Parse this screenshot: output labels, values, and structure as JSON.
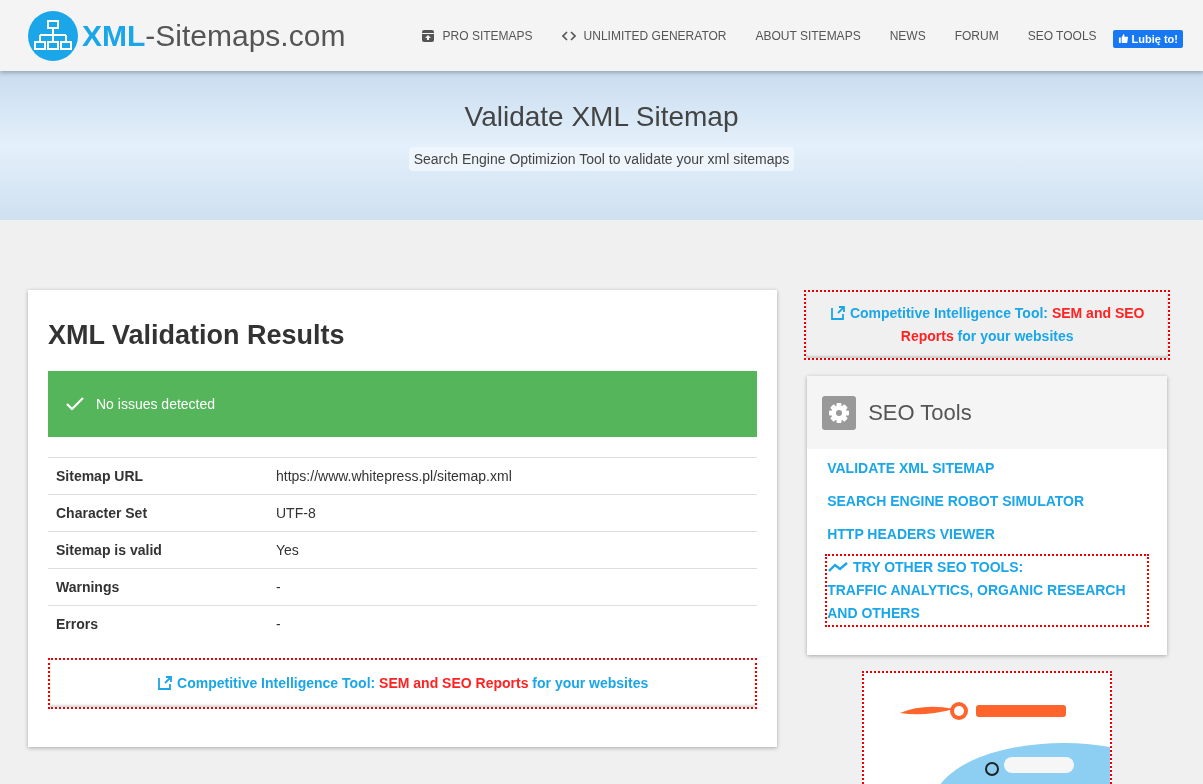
{
  "header": {
    "logo": {
      "brand": "XML",
      "rest": "-Sitemaps.com"
    },
    "nav": [
      {
        "label": "PRO SITEMAPS"
      },
      {
        "label": "UNLIMITED GENERATOR"
      },
      {
        "label": "ABOUT SITEMAPS"
      },
      {
        "label": "NEWS"
      },
      {
        "label": "FORUM"
      },
      {
        "label": "SEO TOOLS"
      }
    ],
    "like_button": "Lubię to!"
  },
  "hero": {
    "title": "Validate XML Sitemap",
    "subtitle": "Search Engine Optimizion Tool to validate your xml sitemaps"
  },
  "results": {
    "title": "XML Validation Results",
    "status": {
      "text": "No issues detected",
      "ok": true
    },
    "rows": [
      {
        "label": "Sitemap URL",
        "value": "https://www.whitepress.pl/sitemap.xml"
      },
      {
        "label": "Character Set",
        "value": "UTF-8"
      },
      {
        "label": "Sitemap is valid",
        "value": "Yes"
      },
      {
        "label": "Warnings",
        "value": "-"
      },
      {
        "label": "Errors",
        "value": "-"
      }
    ],
    "promo": [
      {
        "text": "Competitive Intelligence Tool: ",
        "highlight": false
      },
      {
        "text": "SEM and SEO Reports",
        "highlight": true
      },
      {
        "text": " for your websites",
        "highlight": false
      }
    ]
  },
  "sidebar": {
    "promo": [
      {
        "text": "Competitive Intelligence Tool: ",
        "highlight": false
      },
      {
        "text": "SEM and SEO Reports",
        "highlight": true
      },
      {
        "text": " for your websites",
        "highlight": false
      }
    ],
    "tools": {
      "title": "SEO Tools",
      "links": [
        {
          "label": "VALIDATE XML SITEMAP",
          "focused": false
        },
        {
          "label": "SEARCH ENGINE ROBOT SIMULATOR",
          "focused": false
        },
        {
          "label": "HTTP HEADERS VIEWER",
          "focused": false
        },
        {
          "label": "TRY OTHER SEO TOOLS:",
          "label_2": "TRAFFIC ANALYTICS, ORGANIC RESEARCH AND OTHERS",
          "focused": true,
          "kind": "trend"
        }
      ]
    }
  }
}
